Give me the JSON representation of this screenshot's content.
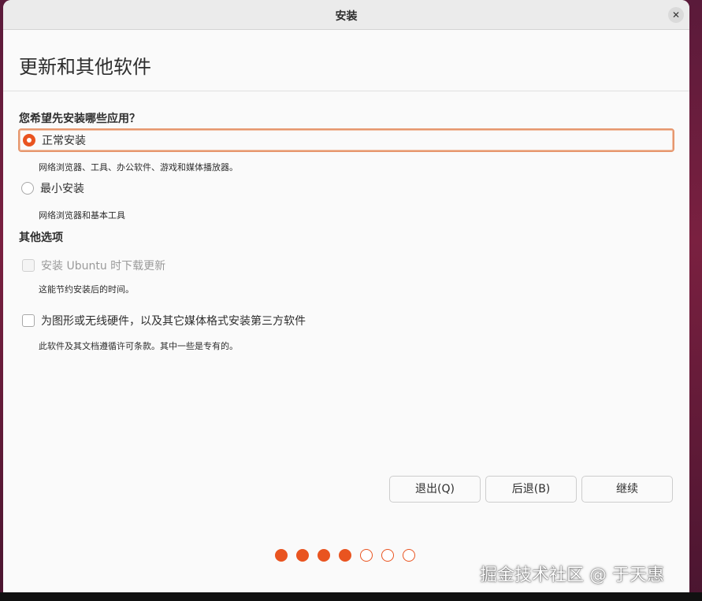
{
  "window": {
    "title": "安装",
    "close_glyph": "✕"
  },
  "header": {
    "title": "更新和其他软件"
  },
  "install_type": {
    "question": "您希望先安装哪些应用？",
    "options": [
      {
        "label": "正常安装",
        "description": "网络浏览器、工具、办公软件、游戏和媒体播放器。",
        "selected": true
      },
      {
        "label": "最小安装",
        "description": "网络浏览器和基本工具",
        "selected": false
      }
    ]
  },
  "other_options": {
    "title": "其他选项",
    "items": [
      {
        "label": "安装 Ubuntu 时下载更新",
        "description": "这能节约安装后的时间。",
        "checked": false,
        "enabled": false
      },
      {
        "label": "为图形或无线硬件，以及其它媒体格式安装第三方软件",
        "description": "此软件及其文档遵循许可条款。其中一些是专有的。",
        "checked": false,
        "enabled": true
      }
    ]
  },
  "buttons": {
    "quit": "退出(Q)",
    "back": "后退(B)",
    "continue": "继续"
  },
  "progress": {
    "total_steps": 7,
    "completed_steps": 4
  },
  "watermark": "掘金技术社区 @ 于天惠",
  "colors": {
    "accent": "#e95420",
    "focus_border": "#e6976e",
    "text": "#2e2e2e",
    "disabled_text": "#9a9a9a"
  }
}
